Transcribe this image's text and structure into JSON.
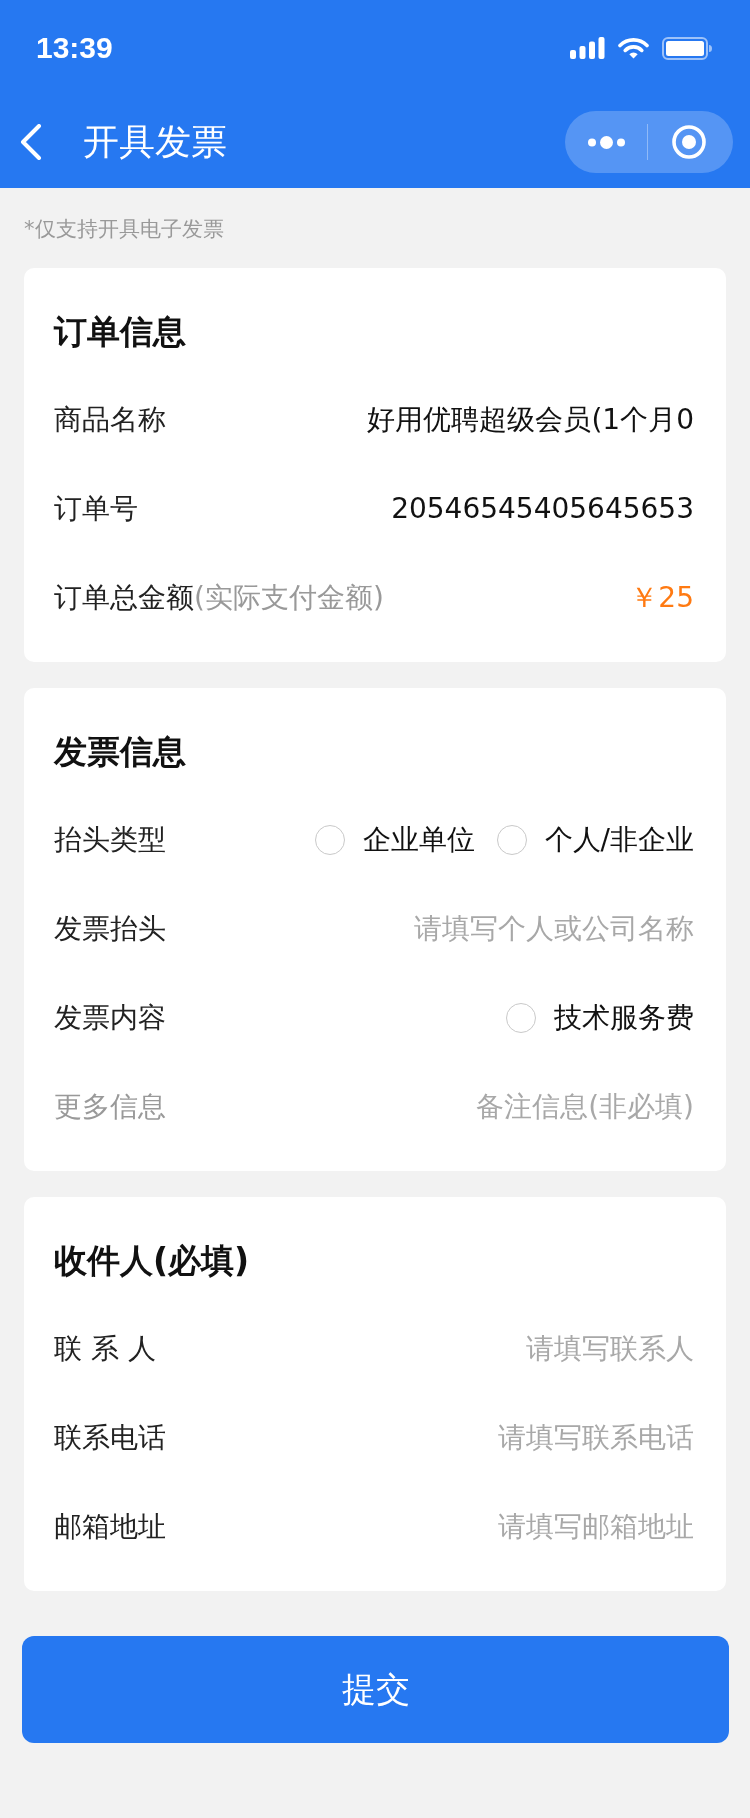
{
  "status_bar": {
    "time": "13:39"
  },
  "nav_bar": {
    "title": "开具发票"
  },
  "notice": "*仅支持开具电子发票",
  "cards": [
    {
      "title": "订单信息",
      "rows": [
        {
          "kind": "text",
          "label": "商品名称",
          "optional": false,
          "value": "好用优聘超级会员(1个月0"
        },
        {
          "kind": "text",
          "label": "订单号",
          "optional": false,
          "value": "20546545405645653"
        },
        {
          "kind": "amount",
          "label": "订单总金额",
          "label_note": "(实际支付金额)",
          "optional": false,
          "value": "￥25"
        }
      ]
    },
    {
      "title": "发票信息",
      "rows": [
        {
          "kind": "radio",
          "label": "抬头类型",
          "optional": false,
          "options": [
            {
              "label": "企业单位",
              "selected": false
            },
            {
              "label": "个人/非企业",
              "selected": false
            }
          ]
        },
        {
          "kind": "input",
          "label": "发票抬头",
          "optional": false,
          "placeholder": "请填写个人或公司名称"
        },
        {
          "kind": "radio",
          "label": "发票内容",
          "optional": false,
          "options": [
            {
              "label": "技术服务费",
              "selected": false
            }
          ]
        },
        {
          "kind": "input",
          "label": "更多信息",
          "optional": true,
          "placeholder": "备注信息(非必填)"
        }
      ]
    },
    {
      "title": "收件人(必填)",
      "rows": [
        {
          "kind": "input",
          "label": "联 系 人",
          "optional": false,
          "placeholder": "请填写联系人"
        },
        {
          "kind": "input",
          "label": "联系电话",
          "optional": false,
          "placeholder": "请填写联系电话"
        },
        {
          "kind": "input",
          "label": "邮箱地址",
          "optional": false,
          "placeholder": "请填写邮箱地址"
        }
      ]
    }
  ],
  "submit_button": {
    "label": "提交"
  }
}
